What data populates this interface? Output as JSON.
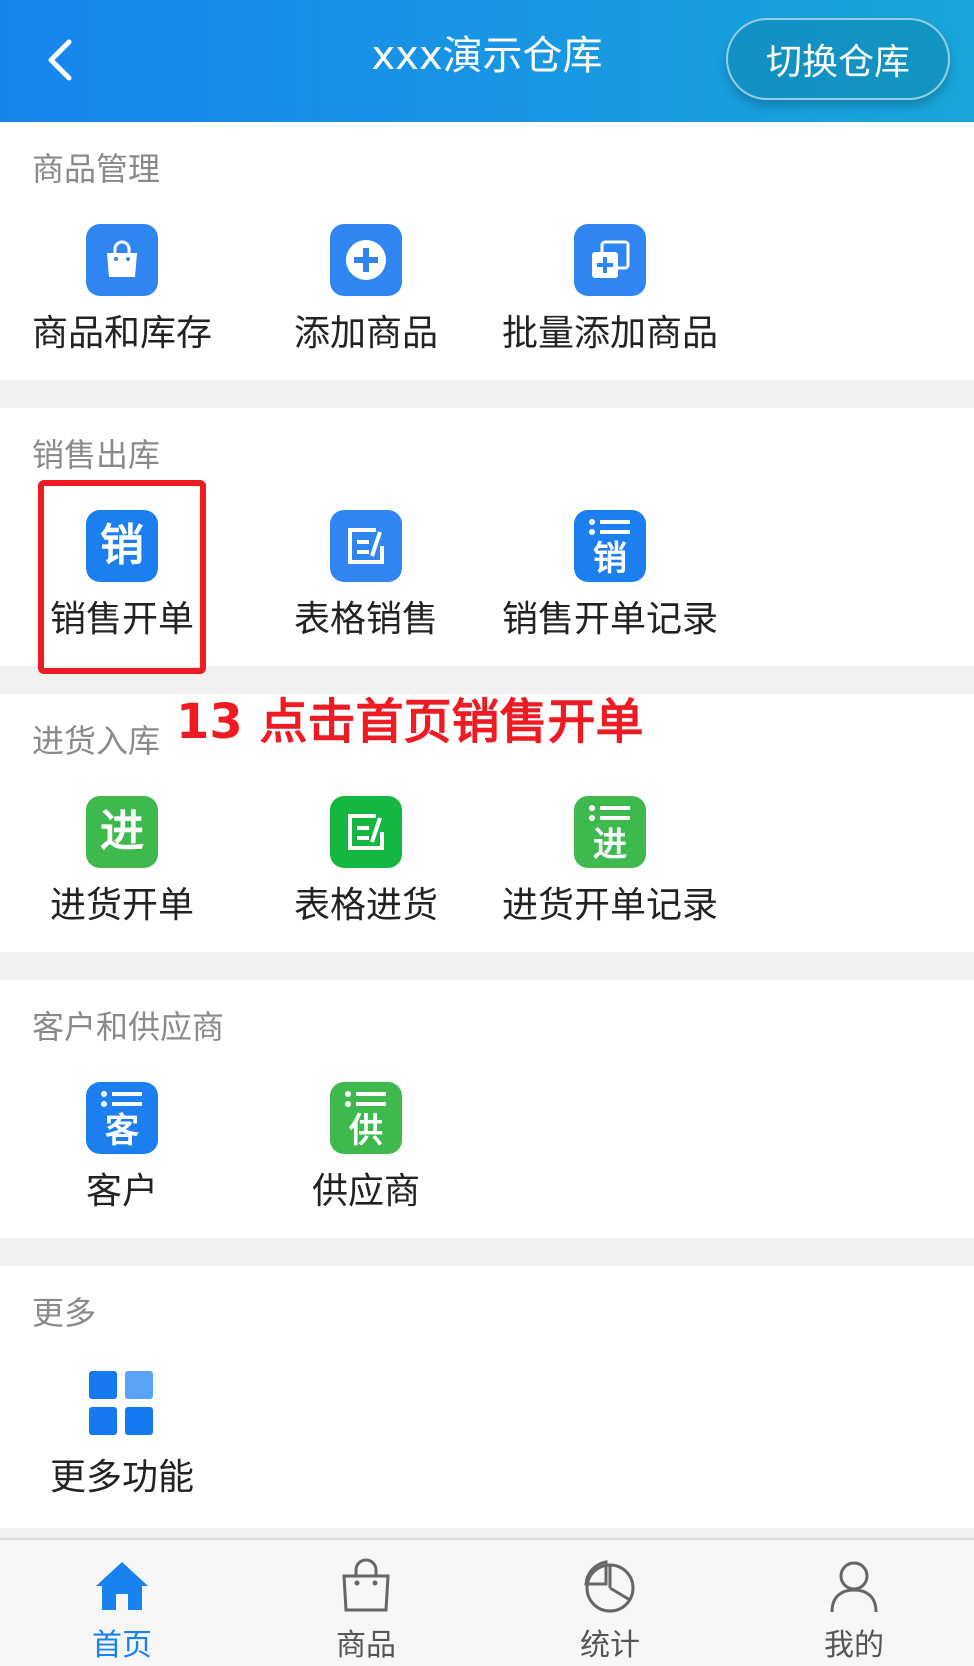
{
  "header": {
    "title": "xxx演示仓库",
    "switch_label": "切换仓库"
  },
  "sections": {
    "goods": {
      "title": "商品管理",
      "items": [
        "商品和库存",
        "添加商品",
        "批量添加商品"
      ]
    },
    "sales": {
      "title": "销售出库",
      "items": [
        "销售开单",
        "表格销售",
        "销售开单记录"
      ]
    },
    "purchase": {
      "title": "进货入库",
      "items": [
        "进货开单",
        "表格进货",
        "进货开单记录"
      ]
    },
    "partners": {
      "title": "客户和供应商",
      "items": [
        "客户",
        "供应商"
      ]
    },
    "more": {
      "title": "更多",
      "items": [
        "更多功能"
      ]
    }
  },
  "icon_chars": {
    "sales": "销",
    "purchase": "进",
    "customer": "客",
    "supplier": "供"
  },
  "annotation": "13 点击首页销售开单",
  "tabbar": {
    "items": [
      "首页",
      "商品",
      "统计",
      "我的"
    ],
    "active_index": 0
  },
  "colors": {
    "header_start": "#1784ee",
    "header_end": "#18a6d9",
    "blue_icon": "#1b7ff0",
    "goods_icon": "#2f86f3",
    "green_icon": "#3db94e",
    "green_icon_bright": "#14b840",
    "highlight": "#ee1b23",
    "tab_active": "#1782f0"
  }
}
